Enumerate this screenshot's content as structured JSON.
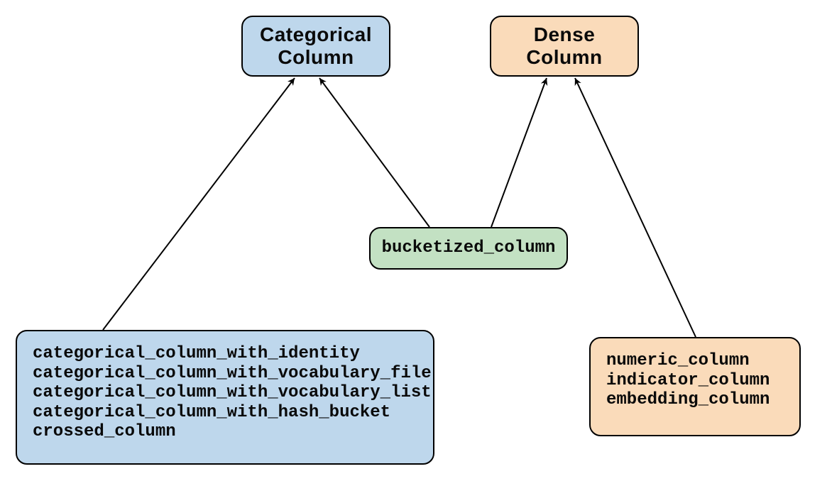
{
  "nodes": {
    "categorical_top": {
      "line1": "Categorical",
      "line2": "Column"
    },
    "dense_top": {
      "line1": "Dense",
      "line2": "Column"
    },
    "bucketized": {
      "label": "bucketized_column"
    },
    "categorical_list": [
      "categorical_column_with_identity",
      "categorical_column_with_vocabulary_file",
      "categorical_column_with_vocabulary_list",
      "categorical_column_with_hash_bucket",
      "crossed_column"
    ],
    "dense_list": [
      "numeric_column",
      "indicator_column",
      "embedding_column"
    ]
  },
  "colors": {
    "blue": "#bed7ec",
    "peach": "#fadbba",
    "green": "#c3e1c3",
    "stroke": "#000000"
  },
  "edges": [
    {
      "from": "categorical_list",
      "to": "categorical_top"
    },
    {
      "from": "bucketized",
      "to": "categorical_top"
    },
    {
      "from": "bucketized",
      "to": "dense_top"
    },
    {
      "from": "dense_list",
      "to": "dense_top"
    }
  ]
}
